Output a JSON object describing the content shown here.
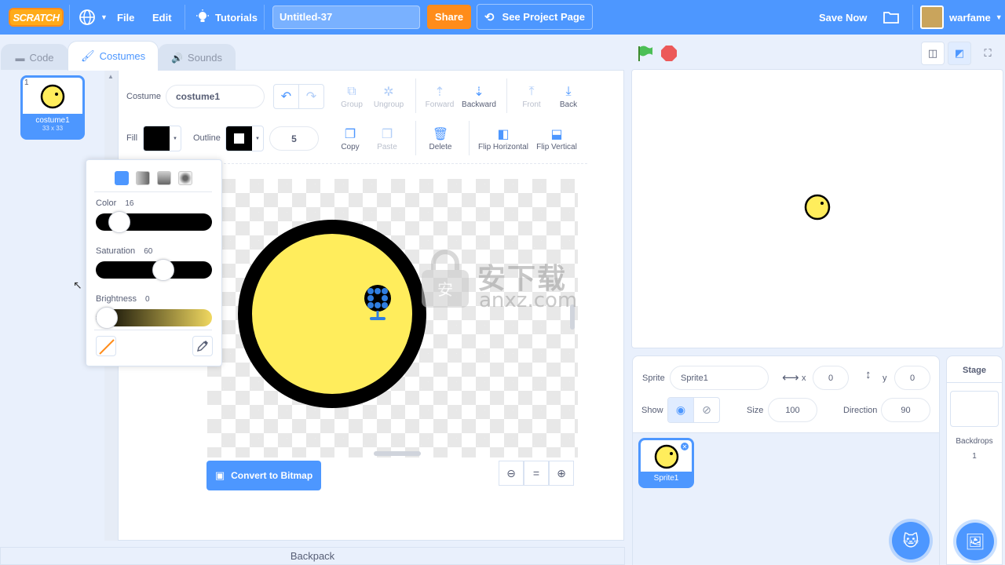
{
  "menubar": {
    "logo": "SCRATCH",
    "file": "File",
    "edit": "Edit",
    "tutorials": "Tutorials",
    "project_title": "Untitled-37",
    "share": "Share",
    "see_project_page": "See Project Page",
    "save_now": "Save Now",
    "username": "warfame"
  },
  "tabs": [
    {
      "label": "Code",
      "icon": "code-icon"
    },
    {
      "label": "Costumes",
      "icon": "paintbrush-icon"
    },
    {
      "label": "Sounds",
      "icon": "speaker-icon"
    }
  ],
  "costume_list": {
    "items": [
      {
        "number": "1",
        "name": "costume1",
        "size": "33 x 33"
      }
    ]
  },
  "editor": {
    "costume_label": "Costume",
    "costume_name": "costume1",
    "fill_label": "Fill",
    "outline_label": "Outline",
    "outline_width": "5",
    "tools": {
      "group": "Group",
      "ungroup": "Ungroup",
      "forward": "Forward",
      "backward": "Backward",
      "front": "Front",
      "back": "Back",
      "copy": "Copy",
      "paste": "Paste",
      "delete": "Delete",
      "flip_horizontal": "Flip Horizontal",
      "flip_vertical": "Flip Vertical"
    },
    "convert_button": "Convert to Bitmap",
    "zoom_reset": "="
  },
  "color_picker": {
    "color_label": "Color",
    "color_value": "16",
    "saturation_label": "Saturation",
    "saturation_value": "60",
    "brightness_label": "Brightness",
    "brightness_value": "0",
    "color_level": 0.16,
    "saturation_level": 0.6,
    "brightness_level": 0.0
  },
  "sprite_info": {
    "sprite_label": "Sprite",
    "sprite_name": "Sprite1",
    "x_label": "x",
    "x_value": "0",
    "y_label": "y",
    "y_value": "0",
    "show_label": "Show",
    "size_label": "Size",
    "size_value": "100",
    "direction_label": "Direction",
    "direction_value": "90"
  },
  "sprites": [
    {
      "name": "Sprite1"
    }
  ],
  "stage_pane": {
    "title": "Stage",
    "backdrops_label": "Backdrops",
    "backdrops_count": "1"
  },
  "backpack": "Backpack",
  "watermark": {
    "cn": "安下载",
    "en": "anxz.com"
  },
  "colors": {
    "accent": "#4d97ff",
    "share": "#ff8c1a",
    "costume_fill": "#ffed5c",
    "outline": "#000000"
  }
}
